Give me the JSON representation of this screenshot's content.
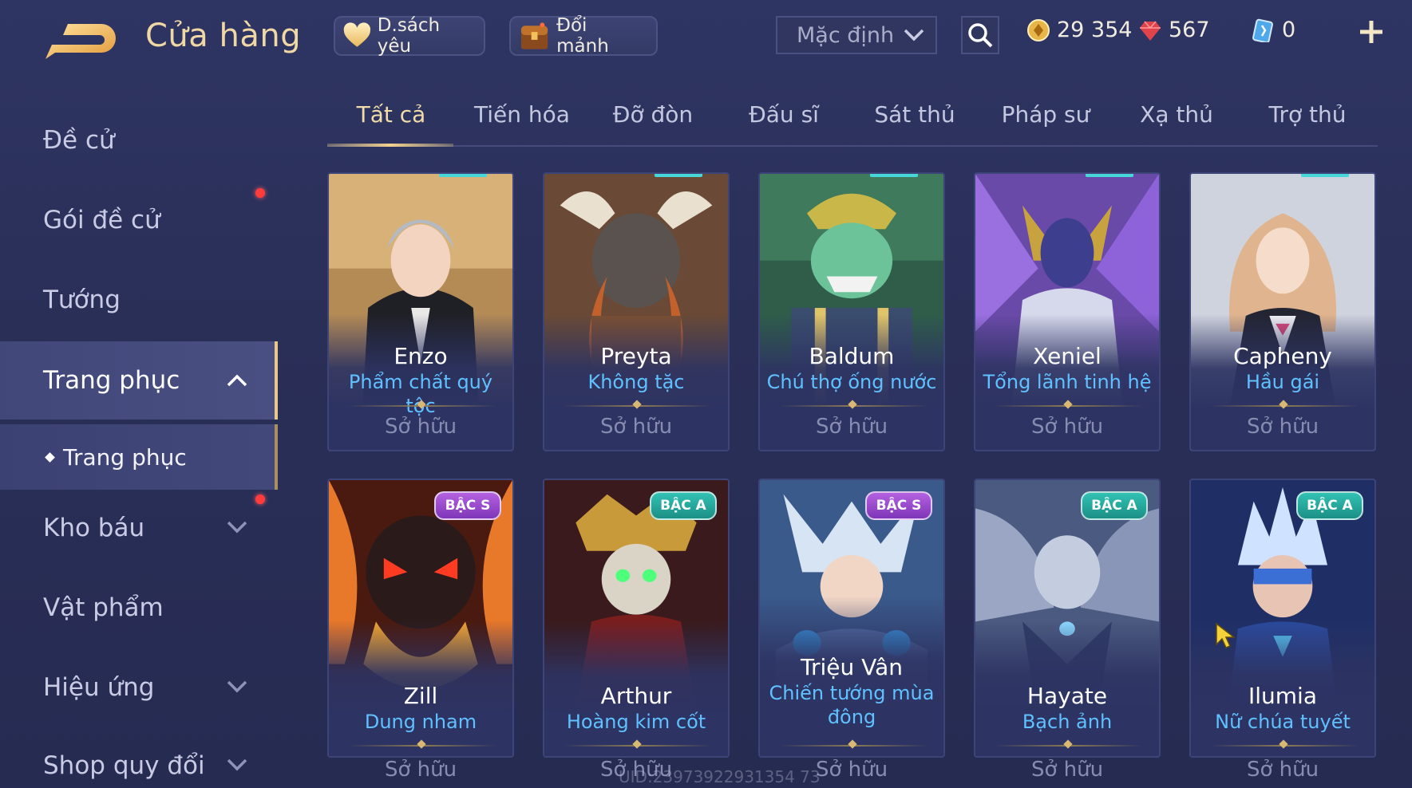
{
  "header": {
    "title": "Cửa hàng",
    "favorites_label": "D.sách yêu",
    "exchange_label": "Đổi mảnh",
    "sort_value": "Mặc định",
    "gold": "29 354",
    "gems": "567",
    "vouchers": "0"
  },
  "sidebar": {
    "items": [
      {
        "label": "Đề cử"
      },
      {
        "label": "Gói đề cử"
      },
      {
        "label": "Tướng"
      },
      {
        "label": "Trang phục"
      },
      {
        "label": "Kho báu"
      },
      {
        "label": "Vật phẩm"
      },
      {
        "label": "Hiệu ứng"
      },
      {
        "label": "Shop quy đổi"
      }
    ],
    "sub_item": "Trang phục"
  },
  "tabs": [
    {
      "label": "Tất cả"
    },
    {
      "label": "Tiến hóa"
    },
    {
      "label": "Đỡ đòn"
    },
    {
      "label": "Đấu sĩ"
    },
    {
      "label": "Sát thủ"
    },
    {
      "label": "Pháp sư"
    },
    {
      "label": "Xạ thủ"
    },
    {
      "label": "Trợ thủ"
    }
  ],
  "cards": [
    {
      "hero": "Enzo",
      "skin": "Phẩm chất quý tộc",
      "status": "Sở hữu",
      "badge": ""
    },
    {
      "hero": "Preyta",
      "skin": "Không tặc",
      "status": "Sở hữu",
      "badge": ""
    },
    {
      "hero": "Baldum",
      "skin": "Chú thợ ống nước",
      "status": "Sở hữu",
      "badge": ""
    },
    {
      "hero": "Xeniel",
      "skin": "Tổng lãnh tinh hệ",
      "status": "Sở hữu",
      "badge": ""
    },
    {
      "hero": "Capheny",
      "skin": "Hầu gái",
      "status": "Sở hữu",
      "badge": ""
    },
    {
      "hero": "Zill",
      "skin": "Dung nham",
      "status": "Sở hữu",
      "badge": "BẬC S"
    },
    {
      "hero": "Arthur",
      "skin": "Hoàng kim cốt",
      "status": "Sở hữu",
      "badge": "BẬC A"
    },
    {
      "hero": "Triệu Vân",
      "skin": "Chiến tướng mùa đông",
      "status": "Sở hữu",
      "badge": "BẬC S"
    },
    {
      "hero": "Hayate",
      "skin": "Bạch ảnh",
      "status": "Sở hữu",
      "badge": "BẬC A"
    },
    {
      "hero": "Ilumia",
      "skin": "Nữ chúa tuyết",
      "status": "Sở hữu",
      "badge": "BẬC A"
    }
  ],
  "uid": "UID:23973922931354 73",
  "colors": {
    "accent_gold": "#f0d8a4",
    "skin_name_blue": "#5fc1ff",
    "tier_s": "#9b4bd0",
    "tier_a": "#26a89c",
    "notification_red": "#ff3b3b"
  },
  "icons": [
    "back-arrow-icon",
    "heart-icon",
    "chest-icon",
    "chevron-down-icon",
    "search-icon",
    "gold-coin-icon",
    "ruby-icon",
    "voucher-icon",
    "plus-icon",
    "chevron-up-icon"
  ]
}
